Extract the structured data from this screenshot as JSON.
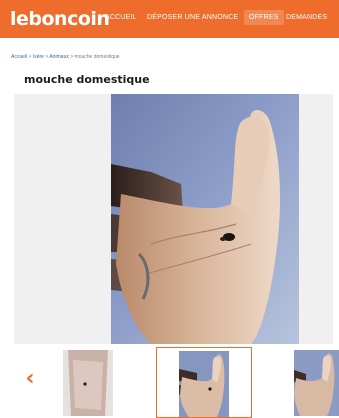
{
  "header": {
    "logo": "leboncoin",
    "nav": [
      {
        "label": "ACCUEIL"
      },
      {
        "label": "DÉPOSER UNE ANNONCE"
      },
      {
        "label": "OFFRES"
      },
      {
        "label": "DEMANDES"
      }
    ]
  },
  "breadcrumb": {
    "items": [
      "Accueil",
      "Isère",
      "Animaux"
    ],
    "separator": " > ",
    "current": "mouche domestique"
  },
  "listing": {
    "title": "mouche domestique"
  },
  "gallery": {
    "prev_icon": "chevron-left-icon",
    "prev_glyph": "‹",
    "photo_count_icon": "photo-stack-icon",
    "thumbnails": [
      {
        "name": "thumbnail-1",
        "selected": false
      },
      {
        "name": "thumbnail-2",
        "selected": true
      },
      {
        "name": "thumbnail-3",
        "selected": false
      }
    ]
  },
  "colors": {
    "brand": "#ee6d2d",
    "link": "#2b6fb5"
  }
}
